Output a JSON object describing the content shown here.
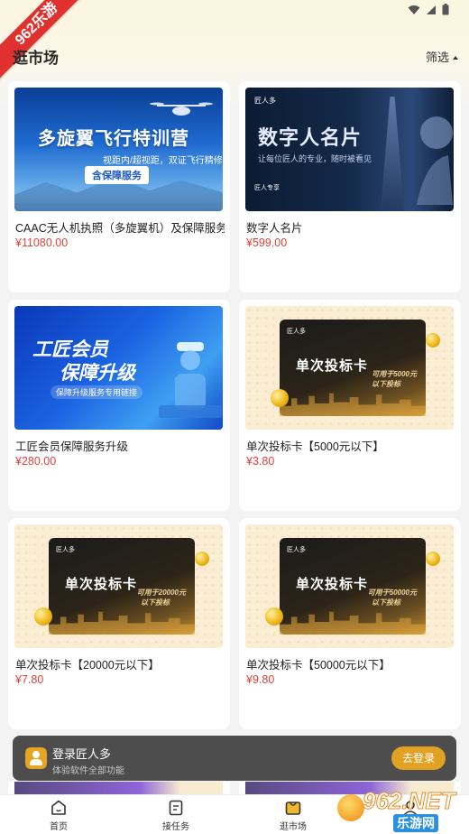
{
  "status_bar": {
    "wifi_icon": "wifi-icon",
    "signal_icon": "signal-icon",
    "battery_icon": "battery-icon"
  },
  "ribbon": {
    "label": "962乐游"
  },
  "header": {
    "title": "逛市场",
    "filter_label": "筛选"
  },
  "products": [
    {
      "title": "CAAC无人机执照（多旋翼机）及保障服务",
      "price": "¥11080.00",
      "thumb": {
        "headline": "多旋翼飞行特训营",
        "subline": "视距内/超视距，双证飞行精修课",
        "pill": "含保障服务"
      }
    },
    {
      "title": "数字人名片",
      "price": "¥599.00",
      "thumb": {
        "headline": "数字人名片",
        "subline": "让每位匠人的专业，随时被看见",
        "logo": "匠人多",
        "badge": "匠人专享"
      }
    },
    {
      "title": "工匠会员保障服务升级",
      "price": "¥280.00",
      "thumb": {
        "headline_1": "工匠会员",
        "headline_2": "保障升级",
        "subline": "保障升级服务专用链接"
      }
    },
    {
      "title": "单次投标卡【5000元以下】",
      "price": "¥3.80",
      "thumb": {
        "logo": "匠人多",
        "card_title": "单次投标卡",
        "note_1": "可用于5000元",
        "note_2": "以下投标"
      }
    },
    {
      "title": "单次投标卡【20000元以下】",
      "price": "¥7.80",
      "thumb": {
        "logo": "匠人多",
        "card_title": "单次投标卡",
        "note_1": "可用于20000元",
        "note_2": "以下投标"
      }
    },
    {
      "title": "单次投标卡【50000元以下】",
      "price": "¥9.80",
      "thumb": {
        "logo": "匠人多",
        "card_title": "单次投标卡",
        "note_1": "可用于50000元",
        "note_2": "以下投标"
      }
    }
  ],
  "login_banner": {
    "title": "登录匠人多",
    "subtitle": "体验软件全部功能",
    "button": "去登录"
  },
  "tabbar": [
    {
      "label": "首页",
      "icon": "home-icon"
    },
    {
      "label": "接任务",
      "icon": "task-icon"
    },
    {
      "label": "逛市场",
      "icon": "market-icon"
    },
    {
      "label": "",
      "icon": "profile-icon"
    }
  ],
  "watermark": {
    "brand": "962.NET",
    "sub": "乐游网"
  },
  "colors": {
    "price": "#e0423a",
    "accent": "#e1a224",
    "banner_bg": "#404040"
  }
}
